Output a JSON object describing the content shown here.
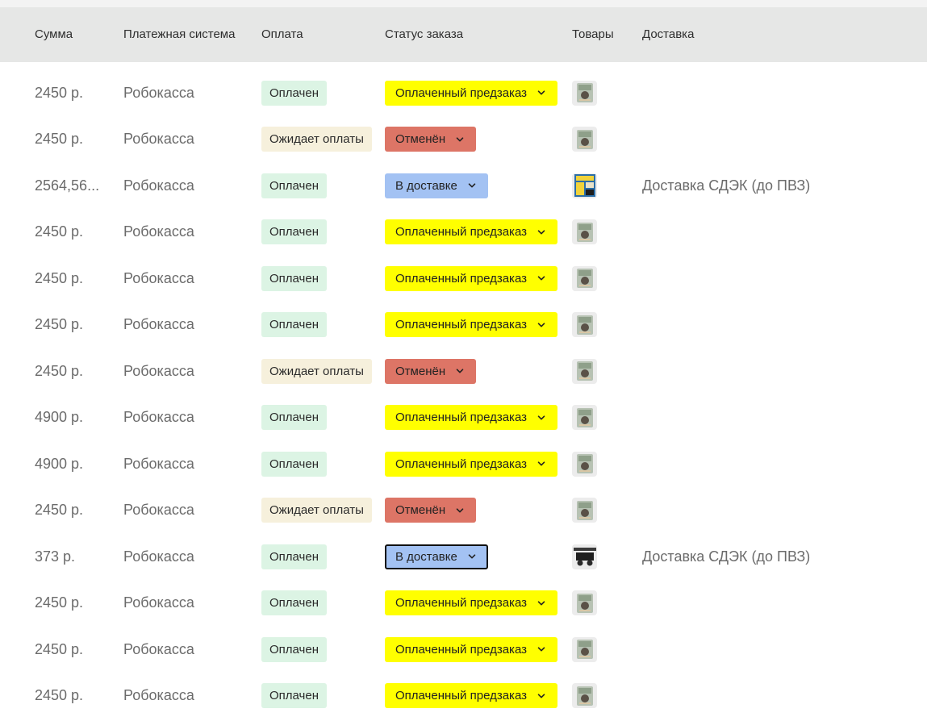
{
  "columns": {
    "sum": "Сумма",
    "payment_system": "Платежная система",
    "payment": "Оплата",
    "status": "Статус заказа",
    "goods": "Товары",
    "delivery": "Доставка"
  },
  "colors": {
    "paid_badge": "#dcf4e4",
    "pending_badge": "#f6f0dc",
    "status_yellow": "#ffff00",
    "status_red": "#dd7566",
    "status_blue": "#a3c2f3",
    "header_bg": "#e6e7e6"
  },
  "rows": [
    {
      "sum": "2450 р.",
      "payment_system": "Робокасса",
      "payment": "Оплачен",
      "payment_state": "paid",
      "status": "Оплаченный предзаказ",
      "status_color": "yellow",
      "goods_icon": "product-box-icon",
      "delivery": ""
    },
    {
      "sum": "2450 р.",
      "payment_system": "Робокасса",
      "payment": "Ожидает оплаты",
      "payment_state": "pending",
      "status": "Отменён",
      "status_color": "red",
      "goods_icon": "product-box-icon",
      "delivery": ""
    },
    {
      "sum": "2564,56...",
      "payment_system": "Робокасса",
      "payment": "Оплачен",
      "payment_state": "paid",
      "status": "В доставке",
      "status_color": "blue",
      "goods_icon": "product-card-icon",
      "delivery": "Доставка СДЭК (до ПВЗ)"
    },
    {
      "sum": "2450 р.",
      "payment_system": "Робокасса",
      "payment": "Оплачен",
      "payment_state": "paid",
      "status": "Оплаченный предзаказ",
      "status_color": "yellow",
      "goods_icon": "product-box-icon",
      "delivery": ""
    },
    {
      "sum": "2450 р.",
      "payment_system": "Робокасса",
      "payment": "Оплачен",
      "payment_state": "paid",
      "status": "Оплаченный предзаказ",
      "status_color": "yellow",
      "goods_icon": "product-box-icon",
      "delivery": ""
    },
    {
      "sum": "2450 р.",
      "payment_system": "Робокасса",
      "payment": "Оплачен",
      "payment_state": "paid",
      "status": "Оплаченный предзаказ",
      "status_color": "yellow",
      "goods_icon": "product-box-icon",
      "delivery": ""
    },
    {
      "sum": "2450 р.",
      "payment_system": "Робокасса",
      "payment": "Ожидает оплаты",
      "payment_state": "pending",
      "status": "Отменён",
      "status_color": "red",
      "goods_icon": "product-box-icon",
      "delivery": ""
    },
    {
      "sum": "4900 р.",
      "payment_system": "Робокасса",
      "payment": "Оплачен",
      "payment_state": "paid",
      "status": "Оплаченный предзаказ",
      "status_color": "yellow",
      "goods_icon": "product-box-icon",
      "delivery": ""
    },
    {
      "sum": "4900 р.",
      "payment_system": "Робокасса",
      "payment": "Оплачен",
      "payment_state": "paid",
      "status": "Оплаченный предзаказ",
      "status_color": "yellow",
      "goods_icon": "product-box-icon",
      "delivery": ""
    },
    {
      "sum": "2450 р.",
      "payment_system": "Робокасса",
      "payment": "Ожидает оплаты",
      "payment_state": "pending",
      "status": "Отменён",
      "status_color": "red",
      "goods_icon": "product-box-icon",
      "delivery": ""
    },
    {
      "sum": "373 р.",
      "payment_system": "Робокасса",
      "payment": "Оплачен",
      "payment_state": "paid",
      "status": "В доставке",
      "status_color": "blue",
      "status_focused": true,
      "goods_icon": "product-dark-icon",
      "delivery": "Доставка СДЭК (до ПВЗ)"
    },
    {
      "sum": "2450 р.",
      "payment_system": "Робокасса",
      "payment": "Оплачен",
      "payment_state": "paid",
      "status": "Оплаченный предзаказ",
      "status_color": "yellow",
      "goods_icon": "product-box-icon",
      "delivery": ""
    },
    {
      "sum": "2450 р.",
      "payment_system": "Робокасса",
      "payment": "Оплачен",
      "payment_state": "paid",
      "status": "Оплаченный предзаказ",
      "status_color": "yellow",
      "goods_icon": "product-box-icon",
      "delivery": ""
    },
    {
      "sum": "2450 р.",
      "payment_system": "Робокасса",
      "payment": "Оплачен",
      "payment_state": "paid",
      "status": "Оплаченный предзаказ",
      "status_color": "yellow",
      "goods_icon": "product-box-icon",
      "delivery": ""
    }
  ]
}
